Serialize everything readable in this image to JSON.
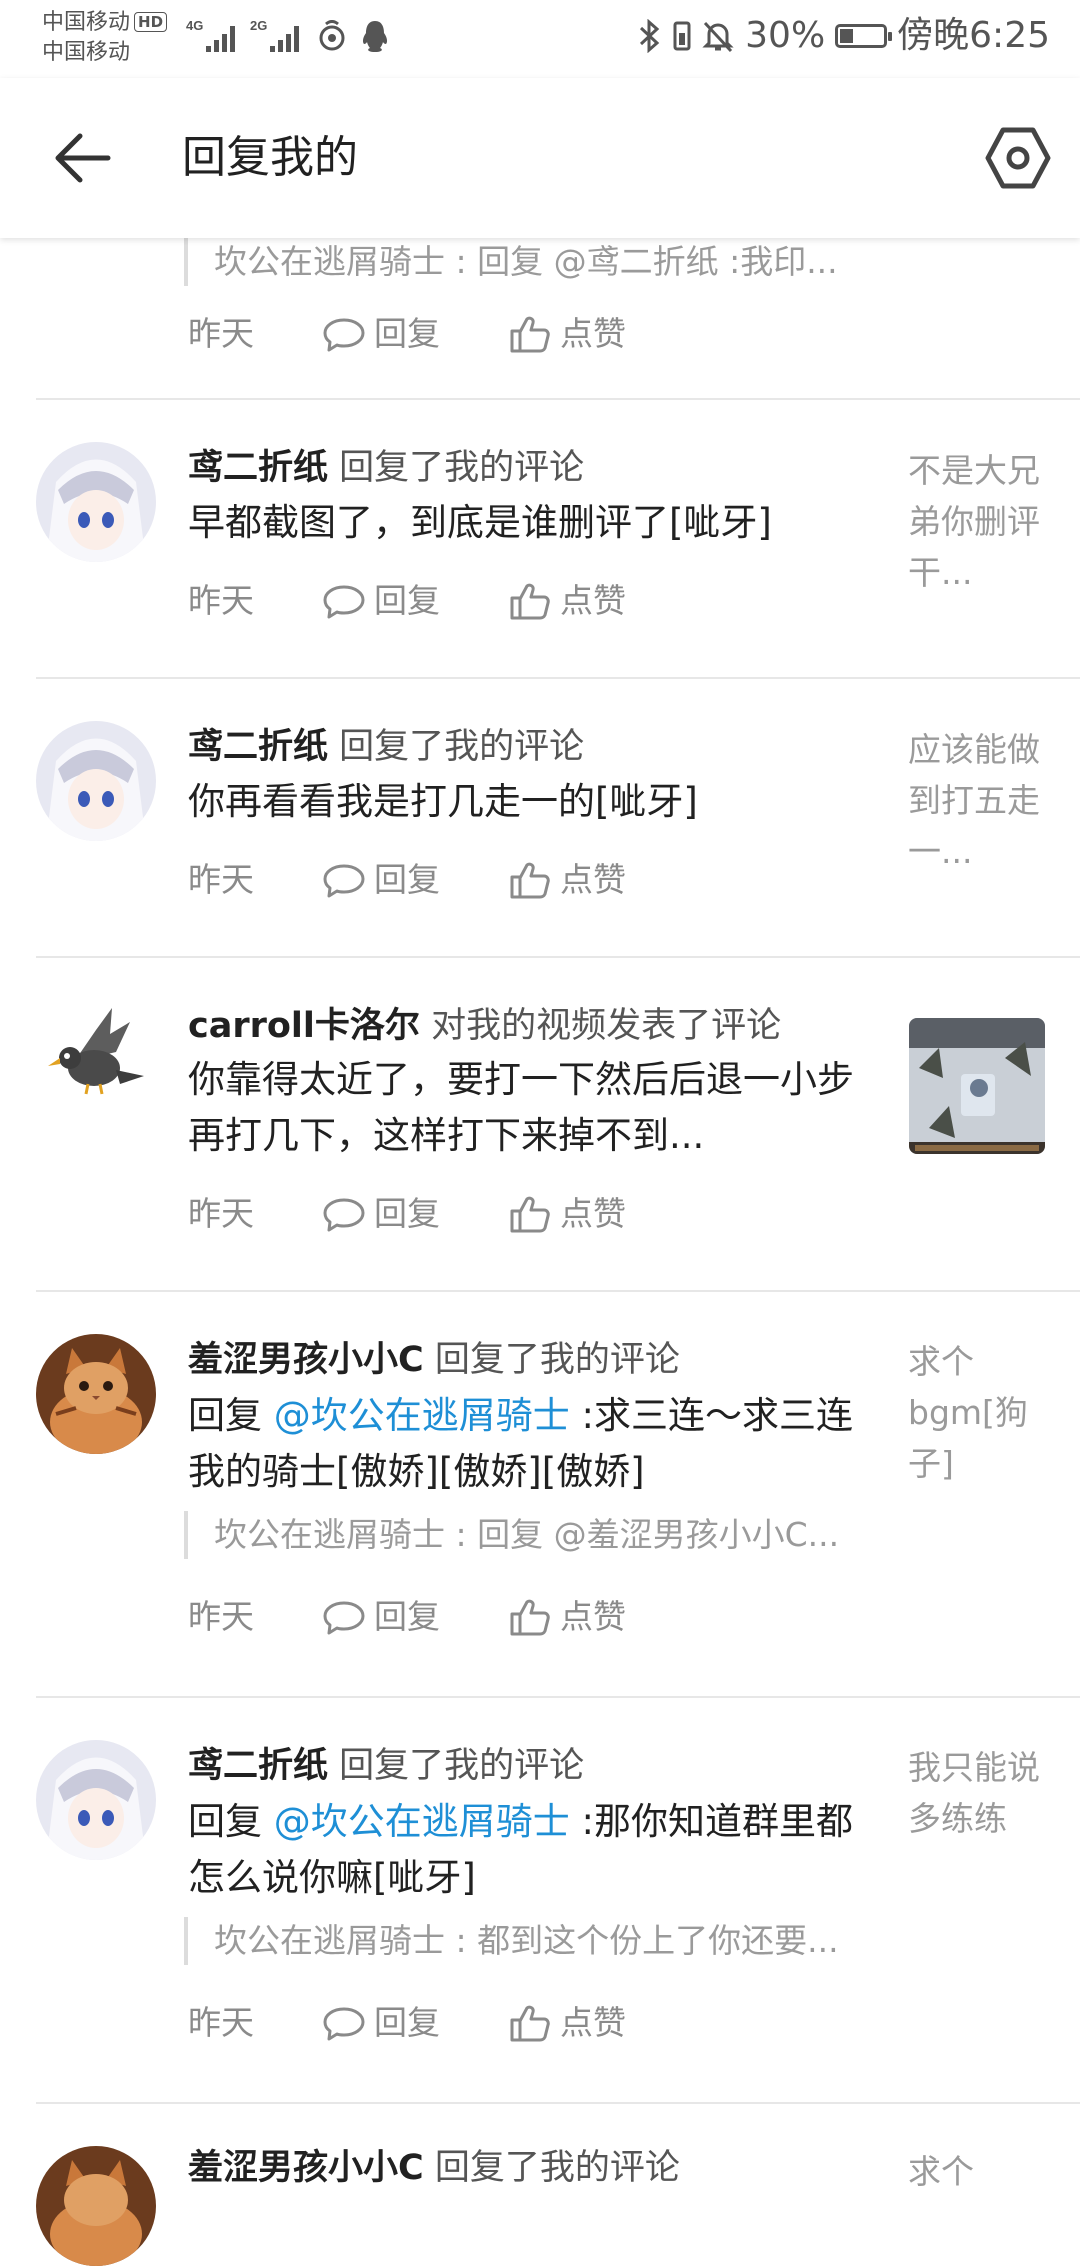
{
  "status_bar": {
    "carrier_1": "中国移动",
    "hd_badge": "HD",
    "carrier_2": "中国移动",
    "net_1": "4G",
    "net_2": "2G",
    "battery": "30%",
    "battery_level": 0.3,
    "time": "傍晚6:25"
  },
  "app_bar": {
    "title": "回复我的"
  },
  "colors": {
    "mention": "#1e8fd6",
    "text": "#212121",
    "secondary": "#9a9a9a"
  },
  "actions": {
    "reply": "回复",
    "like": "点赞"
  },
  "items": [
    {
      "quote": "坎公在逃屑骑士 : 回复 @鸢二折纸 :我印...",
      "time": "昨天"
    },
    {
      "avatar": "anime-girl-avatar",
      "user": "鸢二折纸",
      "action": "回复了我的评论",
      "comment": "早都截图了，到底是谁删评了[呲牙]",
      "time": "昨天",
      "side_text": "不是大兄弟你删评干..."
    },
    {
      "avatar": "anime-girl-avatar",
      "user": "鸢二折纸",
      "action": "回复了我的评论",
      "comment": "你再看看我是打几走一的[呲牙]",
      "time": "昨天",
      "side_text": "应该能做到打五走一..."
    },
    {
      "avatar": "bird-avatar",
      "user": "carroll卡洛尔",
      "action": "对我的视频发表了评论",
      "comment": "你靠得太近了，要打一下然后后退一小步再打几下，这样打下来掉不到...",
      "time": "昨天",
      "thumbnail": "video-thumbnail"
    },
    {
      "avatar": "cat-avatar",
      "user": "羞涩男孩小小C",
      "action": "回复了我的评论",
      "comment_prefix": "回复 ",
      "mention": "@坎公在逃屑骑士",
      "comment": " :求三连～求三连我的骑士[傲娇][傲娇][傲娇]",
      "quote": "坎公在逃屑骑士 : 回复 @羞涩男孩小小C...",
      "time": "昨天",
      "side_text": "求个bgm[狗子]"
    },
    {
      "avatar": "anime-girl-avatar",
      "user": "鸢二折纸",
      "action": "回复了我的评论",
      "comment_prefix": "回复 ",
      "mention": "@坎公在逃屑骑士",
      "comment": " :那你知道群里都怎么说你嘛[呲牙]",
      "quote": "坎公在逃屑骑士 : 都到这个份上了你还要...",
      "time": "昨天",
      "side_text": "我只能说多练练"
    },
    {
      "avatar": "cat-avatar",
      "user": "羞涩男孩小小C",
      "action": "回复了我的评论",
      "side_text": "求个"
    }
  ]
}
